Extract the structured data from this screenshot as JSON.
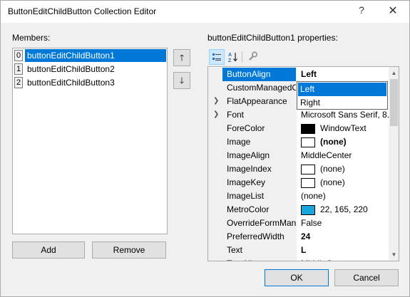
{
  "window": {
    "title": "ButtonEditChildButton Collection Editor",
    "help_glyph": "?",
    "close_glyph": "✕"
  },
  "members": {
    "label": "Members:",
    "items": [
      {
        "index": "0",
        "name": "buttonEditChildButton1",
        "selected": true
      },
      {
        "index": "1",
        "name": "buttonEditChildButton2",
        "selected": false
      },
      {
        "index": "2",
        "name": "buttonEditChildButton3",
        "selected": false
      }
    ],
    "move_up_glyph": "🡑",
    "move_down_glyph": "🡓",
    "add_label": "Add",
    "remove_label": "Remove"
  },
  "properties": {
    "label": "buttonEditChildButton1 properties:",
    "toolbar": {
      "categorized_icon": "categorized-icon",
      "alphabetical_icon": "alphabetical-icon",
      "property_pages_icon": "wrench-icon"
    },
    "rows": [
      {
        "name": "ButtonAlign",
        "value": "Left",
        "bold": true,
        "selected": true
      },
      {
        "name": "CustomManagedC",
        "value": "",
        "bold": false
      },
      {
        "name": "FlatAppearance",
        "value": "",
        "bold": false,
        "expandable": true
      },
      {
        "name": "Font",
        "value": "Microsoft Sans Serif, 8...",
        "bold": false,
        "expandable": true
      },
      {
        "name": "ForeColor",
        "value": "WindowText",
        "swatch": "#000000"
      },
      {
        "name": "Image",
        "value": "(none)",
        "bold": true,
        "swatch": "#ffffff"
      },
      {
        "name": "ImageAlign",
        "value": "MiddleCenter"
      },
      {
        "name": "ImageIndex",
        "value": "(none)",
        "swatch": "#ffffff"
      },
      {
        "name": "ImageKey",
        "value": "(none)",
        "swatch": "#ffffff"
      },
      {
        "name": "ImageList",
        "value": "(none)"
      },
      {
        "name": "MetroColor",
        "value": "22, 165, 220",
        "swatch": "#16a5dc"
      },
      {
        "name": "OverrideFormMana",
        "value": "False"
      },
      {
        "name": "PreferredWidth",
        "value": "24",
        "bold": true
      },
      {
        "name": "Text",
        "value": "L",
        "bold": true
      },
      {
        "name": "TextAlign",
        "value": "MiddleCenter"
      }
    ],
    "dropdown": {
      "options": [
        {
          "label": "Left",
          "selected": true
        },
        {
          "label": "Right",
          "selected": false
        }
      ]
    },
    "combo_glyph": "⌵",
    "expander_glyph": "❯"
  },
  "footer": {
    "ok_label": "OK",
    "cancel_label": "Cancel"
  },
  "colors": {
    "accent": "#0078d7",
    "metro": "#16a5dc"
  }
}
